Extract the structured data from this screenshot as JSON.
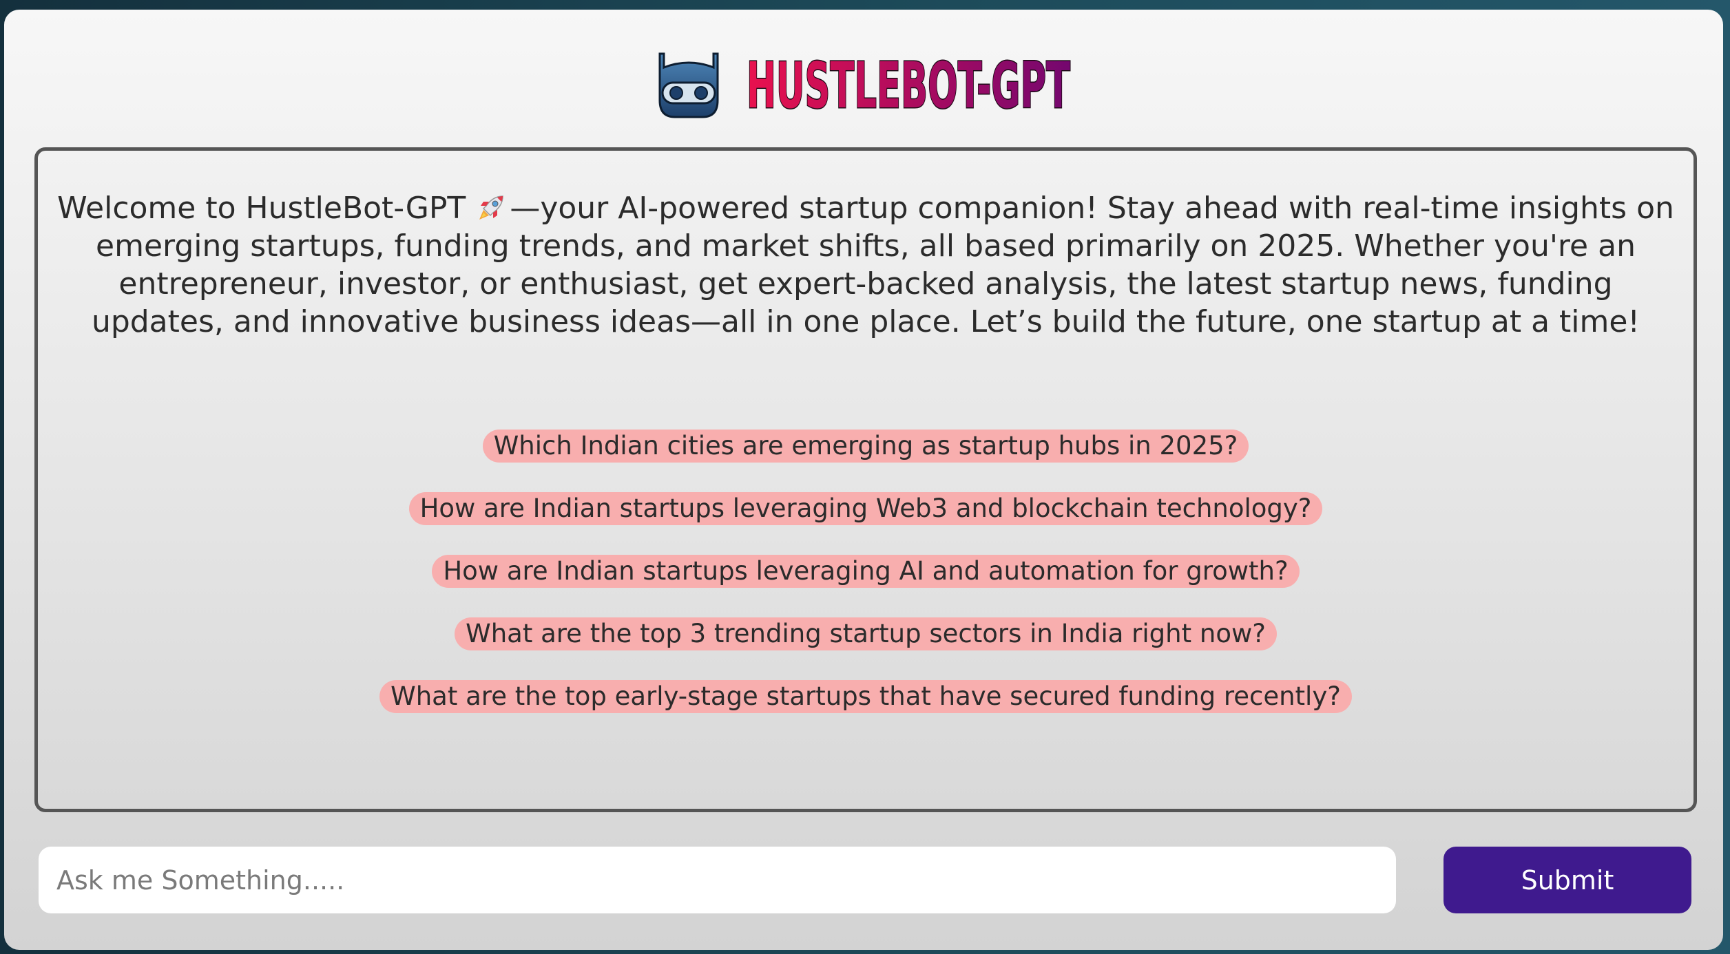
{
  "brand": {
    "name": "HUSTLEBOT-GPT",
    "logo_icon": "robot-head-icon",
    "gradient_start": "#e9114e",
    "gradient_end": "#74076f"
  },
  "welcome": {
    "text_before_icon": "Welcome to HustleBot-GPT",
    "icon": "rocket-icon",
    "text_after_icon": "—your AI-powered startup companion! Stay ahead with real-time insights on emerging startups, funding trends, and market shifts, all based primarily on 2025. Whether you're an entrepreneur, investor, or enthusiast, get expert-backed analysis, the latest startup news, funding updates, and innovative business ideas—all in one place. Let’s build the future, one startup at a time!"
  },
  "suggestions": [
    "Which Indian cities are emerging as startup hubs in 2025?",
    "How are Indian startups leveraging Web3 and blockchain technology?",
    "How are Indian startups leveraging AI and automation for growth?",
    "What are the top 3 trending startup sectors in India right now?",
    "What are the top early-stage startups that have secured funding recently?"
  ],
  "input": {
    "placeholder": "Ask me Something.....",
    "value": ""
  },
  "submit": {
    "label": "Submit",
    "color": "#3f1a8e"
  },
  "colors": {
    "chip_background": "#f8aeae",
    "panel_border": "#555555"
  }
}
